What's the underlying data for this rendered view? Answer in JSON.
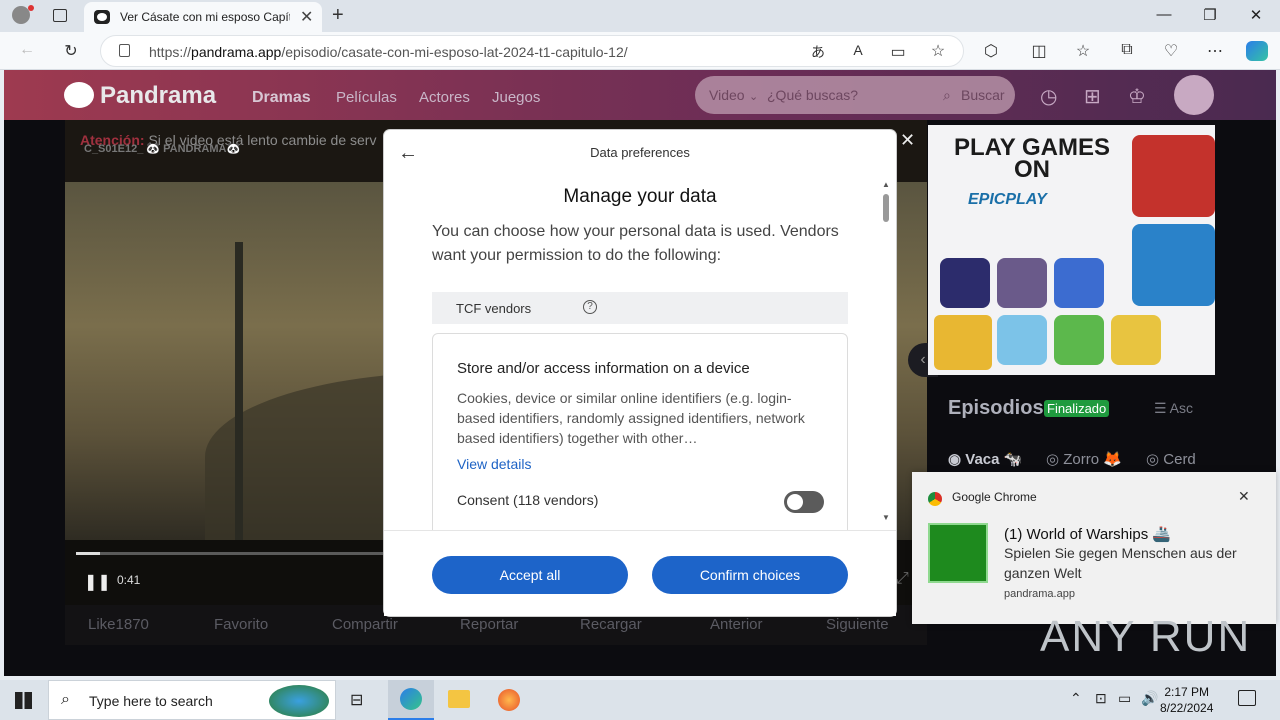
{
  "browser": {
    "tab_title": "Ver Cásate con mi esposo Capítul",
    "url_prefix": "https://",
    "url_host": "pandrama.app",
    "url_path": "/episodio/casate-con-mi-esposo-lat-2024-t1-capitulo-12/"
  },
  "site": {
    "logo": "Pandrama",
    "nav": [
      "Dramas",
      "Películas",
      "Actores",
      "Juegos"
    ],
    "search_type": "Video",
    "search_placeholder": "¿Qué buscas?",
    "search_button": "Buscar"
  },
  "player": {
    "attention_label": "Atención:",
    "attention_text": "Si el video está lento cambie de serv",
    "watermark": "C_S01E12_ 🐼 PANDRAMA🐼",
    "time": "0:41",
    "progress": 0.03,
    "actions": [
      "Like1870",
      "Favorito",
      "Compartir",
      "Reportar",
      "Recargar",
      "Anterior",
      "Siguiente"
    ]
  },
  "ad": {
    "title": "PLAY GAMES ON",
    "brand": "EPICPLAY"
  },
  "episodes": {
    "title": "Episodios",
    "status": "Finalizado",
    "sort": "Asc",
    "seasons": [
      "Vaca 🐄",
      "Zorro 🦊",
      "Cerd"
    ]
  },
  "modal": {
    "header": "Data preferences",
    "title": "Manage your data",
    "description": "You can choose how your personal data is used. Vendors want your permission to do the following:",
    "section": "TCF vendors",
    "card_title": "Store and/or access information on a device",
    "card_desc": "Cookies, device or similar online identifiers (e.g. login-based identifiers, randomly assigned identifiers, network based identifiers) together with other…",
    "view_details": "View details",
    "consent": "Consent (118 vendors)",
    "accept_all": "Accept all",
    "confirm": "Confirm choices"
  },
  "notification": {
    "app": "Google Chrome",
    "title": "(1) World of Warships 🚢",
    "body": "Spielen Sie gegen Menschen aus der ganzen Welt",
    "source": "pandrama.app"
  },
  "taskbar": {
    "search_placeholder": "Type here to search",
    "time": "2:17 PM",
    "date": "8/22/2024"
  },
  "watermark": "ANY RUN"
}
